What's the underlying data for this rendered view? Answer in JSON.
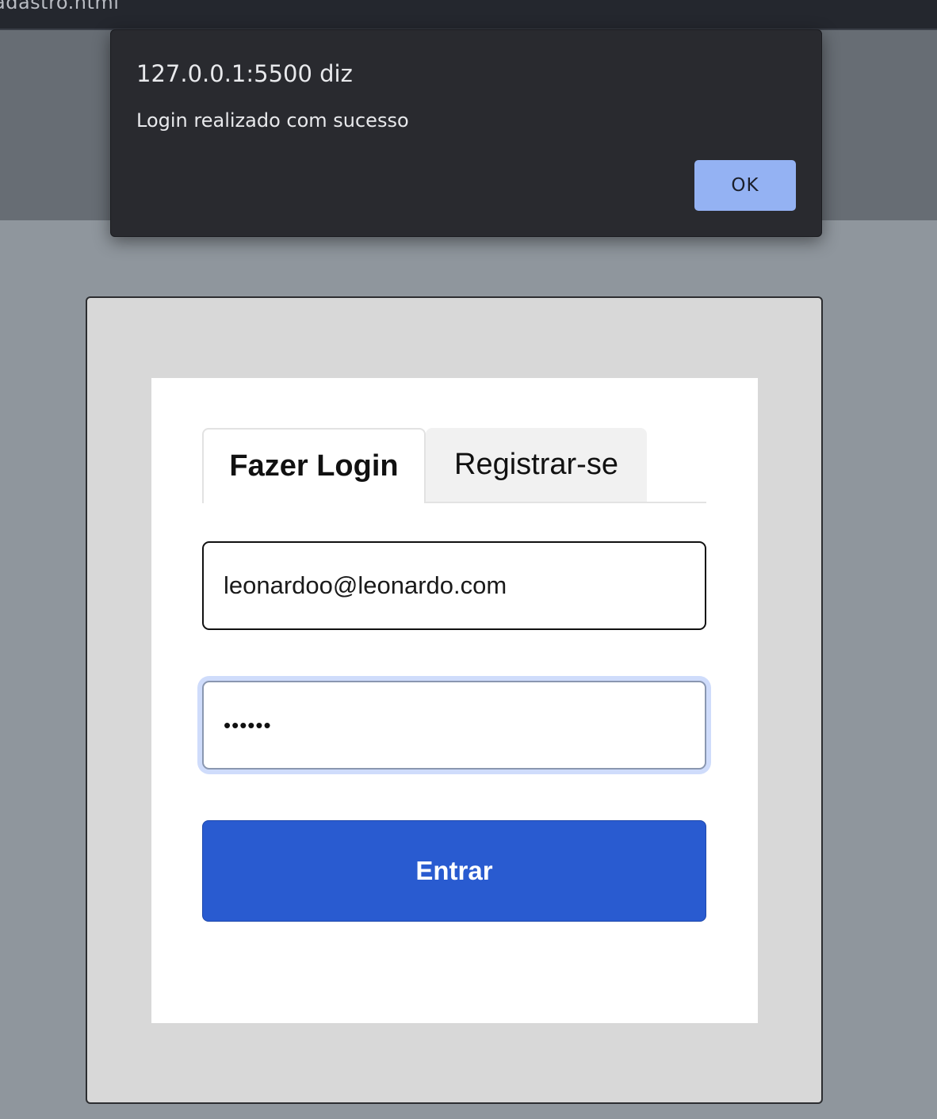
{
  "browser": {
    "tab_title": "adastro.html"
  },
  "alert": {
    "origin": "127.0.0.1:5500 diz",
    "message": "Login realizado com sucesso",
    "ok_label": "OK"
  },
  "login_form": {
    "tabs": [
      {
        "label": "Fazer Login",
        "active": true
      },
      {
        "label": "Registrar-se",
        "active": false
      }
    ],
    "email_value": "leonardoo@leonardo.com",
    "password_masked": "••••••",
    "submit_label": "Entrar"
  },
  "colors": {
    "primary_button": "#295bd0",
    "alert_button": "#94b2f3",
    "focus_ring": "#cfdcfb"
  }
}
